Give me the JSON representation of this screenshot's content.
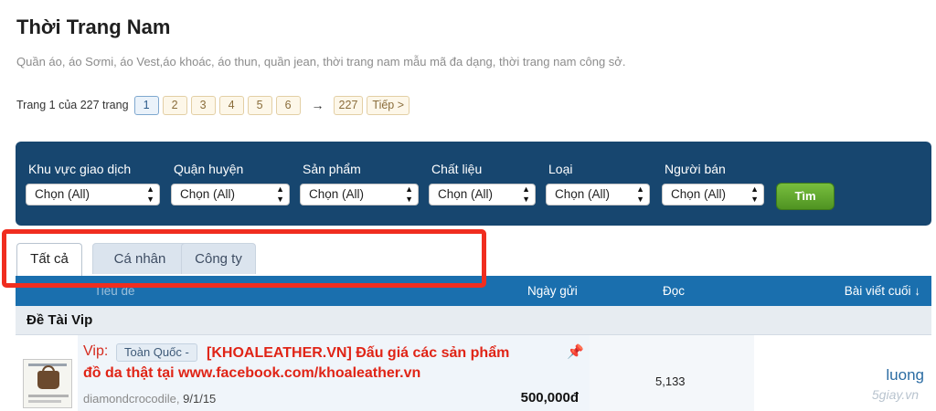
{
  "page": {
    "title": "Thời Trang Nam",
    "description": "Quần áo, áo Sơmi, áo Vest,áo khoác, áo thun, quần jean, thời trang nam mẫu mã đa dạng, thời trang nam công sở."
  },
  "pagination": {
    "summary": "Trang 1 của 227 trang",
    "pages": [
      "1",
      "2",
      "3",
      "4",
      "5",
      "6"
    ],
    "arrow": "→",
    "last_page": "227",
    "next_label": "Tiếp >"
  },
  "filters": {
    "items": [
      {
        "label": "Khu vực giao dịch",
        "value": "Chọn (All)"
      },
      {
        "label": "Quận huyện",
        "value": "Chọn (All)"
      },
      {
        "label": "Sản phẩm",
        "value": "Chọn (All)"
      },
      {
        "label": "Chất liệu",
        "value": "Chọn (All)"
      },
      {
        "label": "Loại",
        "value": "Chọn (All)"
      },
      {
        "label": "Người bán",
        "value": "Chọn (All)"
      }
    ],
    "search_label": "Tìm"
  },
  "tabs": [
    {
      "label": "Tất cả",
      "active": true
    },
    {
      "label": "Cá nhân",
      "active": false
    },
    {
      "label": "Công ty",
      "active": false
    }
  ],
  "table": {
    "headers": {
      "title": "Tiêu đề",
      "date": "Ngày gửi",
      "read": "Đọc",
      "last_post": "Bài viết cuối ↓"
    },
    "section": "Đề Tài Vip",
    "thread": {
      "prefix": "Vip:",
      "region": "Toàn Quốc -",
      "title_line1": "[KHOALEATHER.VN] Đấu giá các sản phẩm",
      "title_line2": "đồ da thật tại www.facebook.com/khoaleather.vn",
      "author": "diamondcrocodile,",
      "date": "9/1/15",
      "price": "500,000đ",
      "read_count": "5,133",
      "last_poster": "luong",
      "watermark": "5giay.vn"
    }
  },
  "colors": {
    "filter_panel": "#17466f",
    "table_header": "#1a6fae",
    "search_button": "#5ea52c",
    "highlight": "#f02d1f",
    "vip_title": "#e02416"
  },
  "icons": {
    "pin": "pushpin-icon",
    "select_arrows": "updown-arrows-icon"
  }
}
